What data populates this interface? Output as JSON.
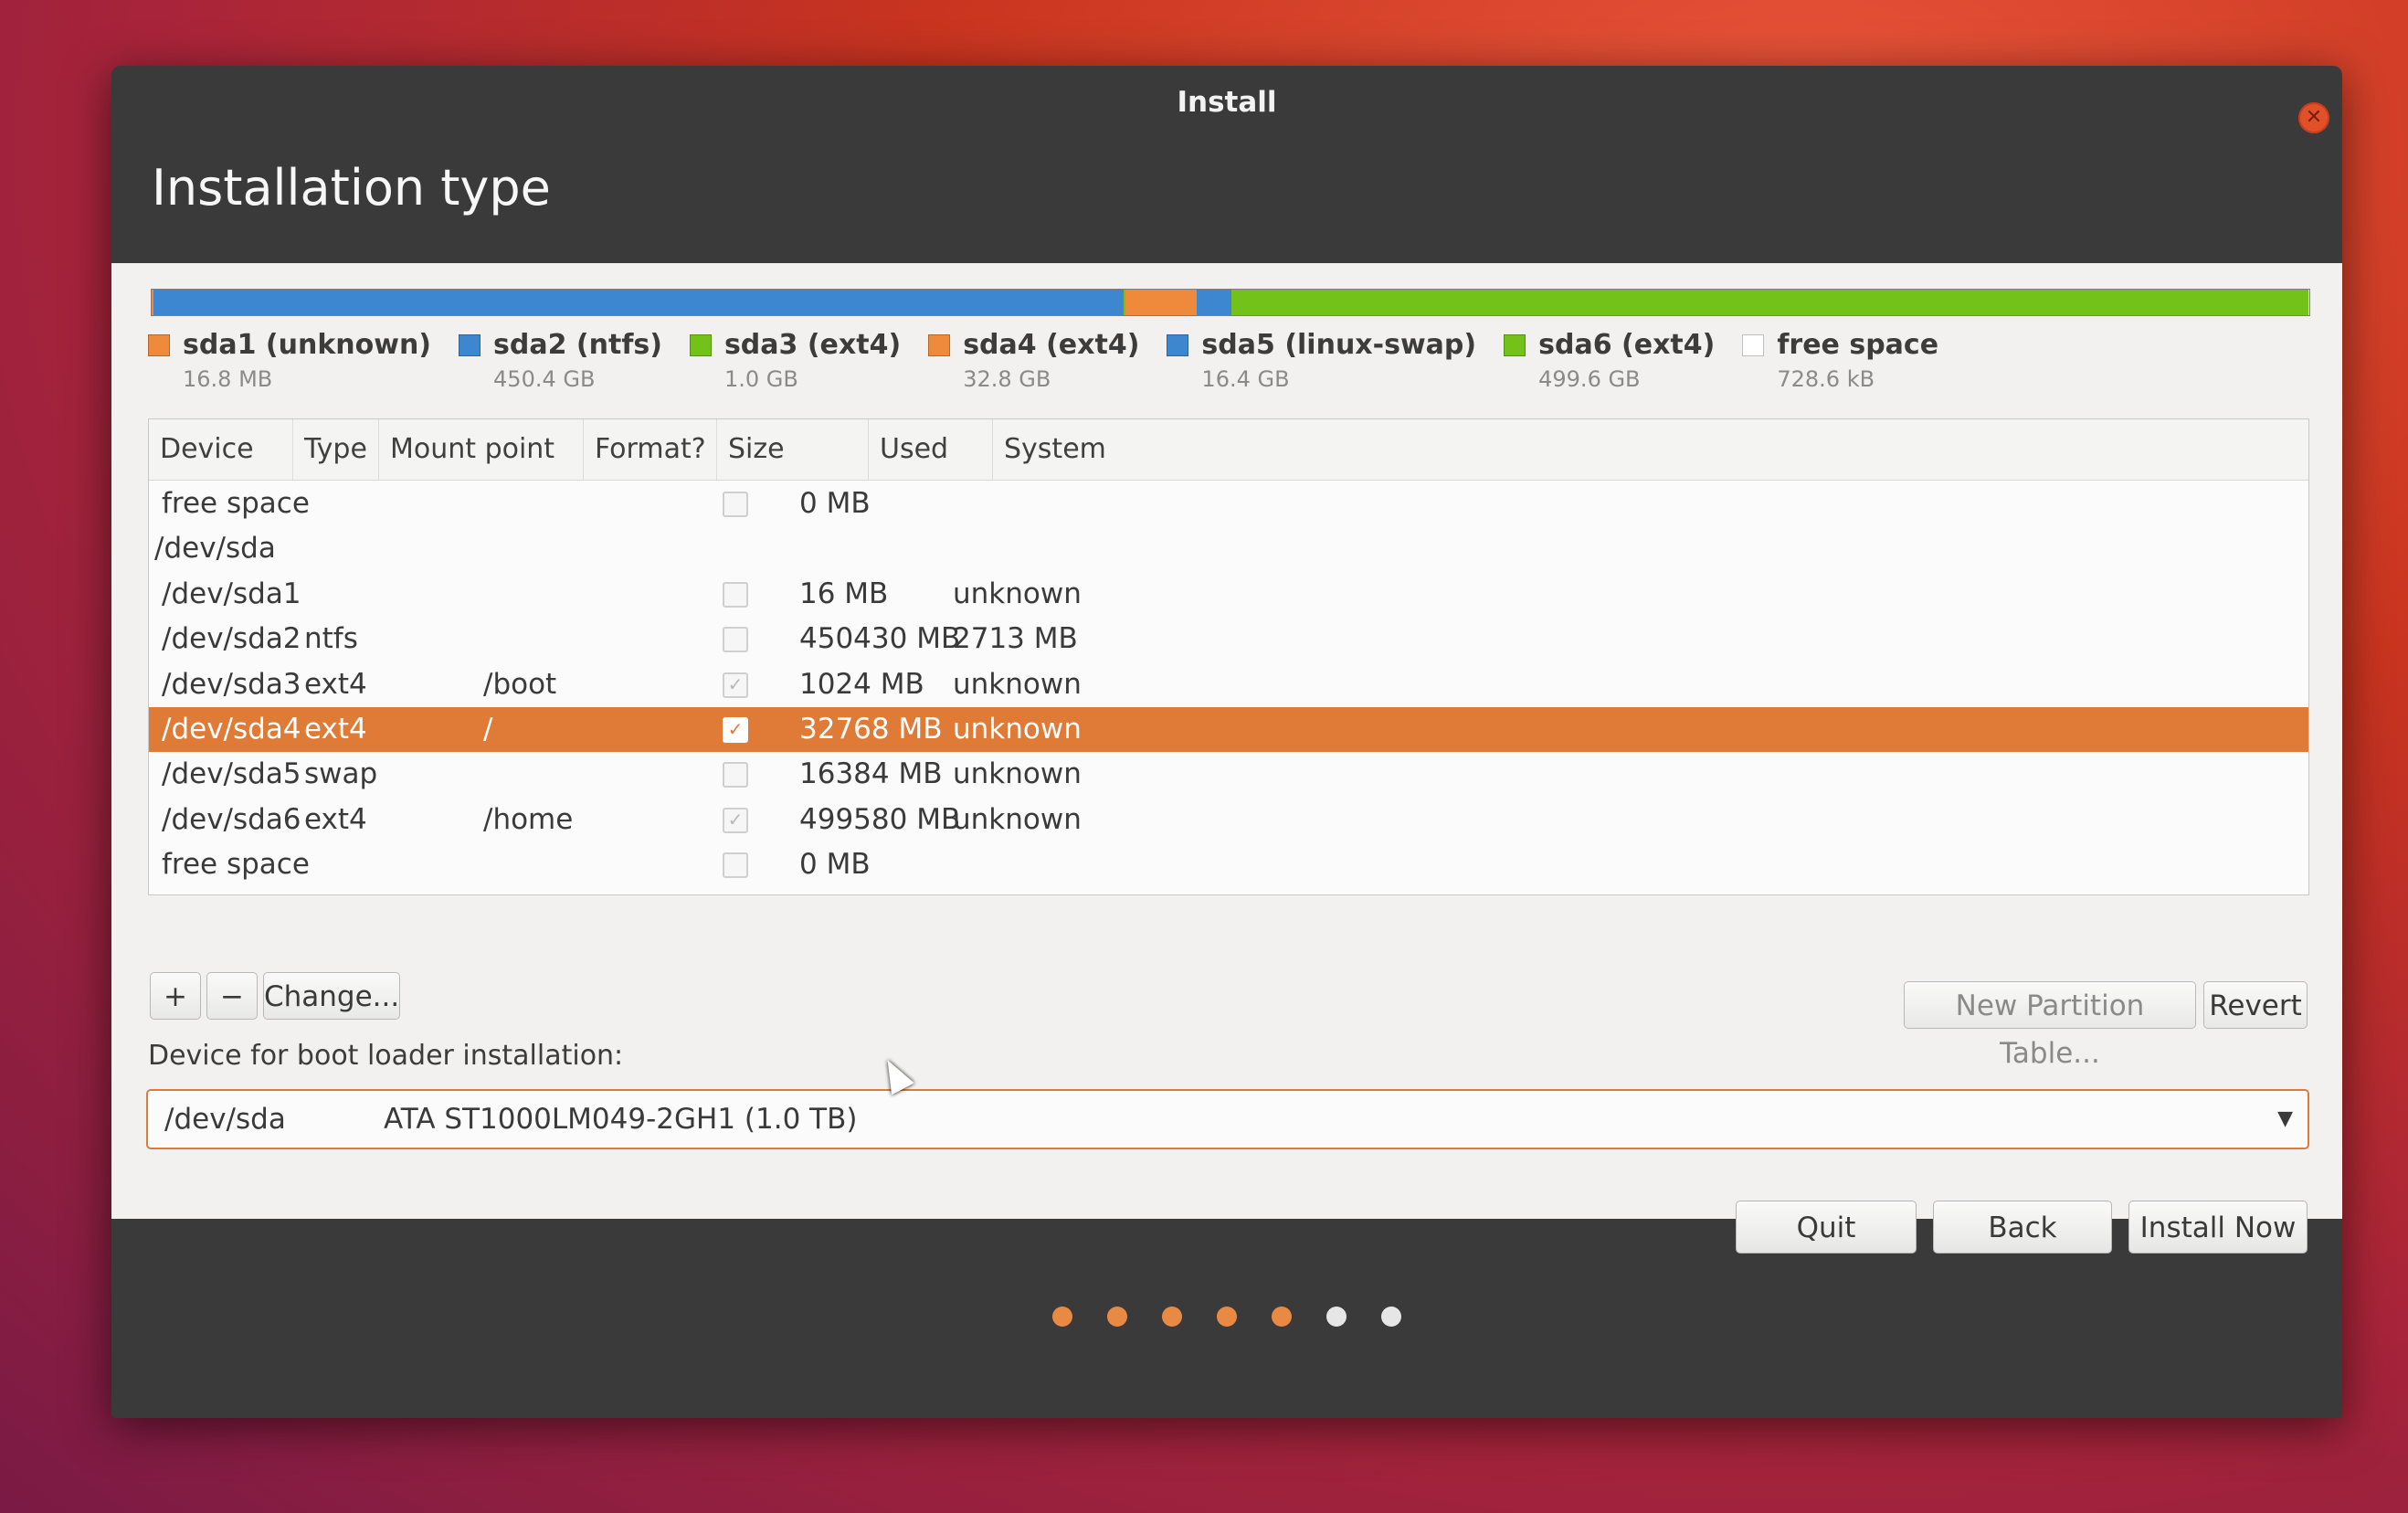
{
  "window": {
    "title": "Install",
    "close_icon": "close-icon"
  },
  "page_title": "Installation type",
  "partition_bar": {
    "colors": {
      "blue": "#3d86d0",
      "orange": "#ef8a3c",
      "green": "#73c21a"
    },
    "segments": [
      {
        "name": "sda1",
        "color": "orange",
        "fraction": 2e-05
      },
      {
        "name": "sda2",
        "color": "blue",
        "fraction": 0.45
      },
      {
        "name": "sda3",
        "color": "green",
        "fraction": 0.001
      },
      {
        "name": "sda4",
        "color": "orange",
        "fraction": 0.033
      },
      {
        "name": "sda5",
        "color": "blue",
        "fraction": 0.016
      },
      {
        "name": "sda6",
        "color": "green",
        "fraction": 0.4995
      }
    ]
  },
  "legend": [
    {
      "name": "sda1 (unknown)",
      "size": "16.8 MB",
      "color": "#ef8a3c"
    },
    {
      "name": "sda2 (ntfs)",
      "size": "450.4 GB",
      "color": "#3d86d0"
    },
    {
      "name": "sda3 (ext4)",
      "size": "1.0 GB",
      "color": "#73c21a"
    },
    {
      "name": "sda4 (ext4)",
      "size": "32.8 GB",
      "color": "#ef8a3c"
    },
    {
      "name": "sda5 (linux-swap)",
      "size": "16.4 GB",
      "color": "#3d86d0"
    },
    {
      "name": "sda6 (ext4)",
      "size": "499.6 GB",
      "color": "#73c21a"
    },
    {
      "name": "free space",
      "size": "728.6 kB",
      "color": "#ffffff"
    }
  ],
  "table": {
    "headers": [
      "Device",
      "Type",
      "Mount point",
      "Format?",
      "Size",
      "Used",
      "System"
    ],
    "rows": [
      {
        "device": "free space",
        "type": "",
        "mount": "",
        "format": false,
        "show_check": true,
        "size": "0 MB",
        "used": "",
        "system": "",
        "selected": false
      },
      {
        "device": "/dev/sda",
        "type": "",
        "mount": "",
        "format": false,
        "show_check": false,
        "size": "",
        "used": "",
        "system": "",
        "selected": false
      },
      {
        "device": "/dev/sda1",
        "type": "",
        "mount": "",
        "format": false,
        "show_check": true,
        "size": "16 MB",
        "used": "unknown",
        "system": "",
        "selected": false
      },
      {
        "device": "/dev/sda2",
        "type": "ntfs",
        "mount": "",
        "format": false,
        "show_check": true,
        "size": "450430 MB",
        "used": "2713 MB",
        "system": "",
        "selected": false
      },
      {
        "device": "/dev/sda3",
        "type": "ext4",
        "mount": "/boot",
        "format": true,
        "show_check": true,
        "size": "1024 MB",
        "used": "unknown",
        "system": "",
        "selected": false
      },
      {
        "device": "/dev/sda4",
        "type": "ext4",
        "mount": "/",
        "format": true,
        "show_check": true,
        "size": "32768 MB",
        "used": "unknown",
        "system": "",
        "selected": true
      },
      {
        "device": "/dev/sda5",
        "type": "swap",
        "mount": "",
        "format": false,
        "show_check": true,
        "size": "16384 MB",
        "used": "unknown",
        "system": "",
        "selected": false
      },
      {
        "device": "/dev/sda6",
        "type": "ext4",
        "mount": "/home",
        "format": true,
        "show_check": true,
        "size": "499580 MB",
        "used": "unknown",
        "system": "",
        "selected": false
      },
      {
        "device": "free space",
        "type": "",
        "mount": "",
        "format": false,
        "show_check": true,
        "size": "0 MB",
        "used": "",
        "system": "",
        "selected": false
      }
    ]
  },
  "toolbar": {
    "add_label": "+",
    "remove_label": "−",
    "change_label": "Change...",
    "new_table_label": "New Partition Table...",
    "revert_label": "Revert"
  },
  "boot_loader": {
    "label": "Device for boot loader installation:",
    "device": "/dev/sda",
    "disk": "ATA ST1000LM049-2GH1 (1.0 TB)"
  },
  "buttons": {
    "quit": "Quit",
    "back": "Back",
    "install": "Install Now"
  },
  "progress": {
    "completed_steps": 5,
    "total_steps": 7
  },
  "accent_color": "#e07a37"
}
